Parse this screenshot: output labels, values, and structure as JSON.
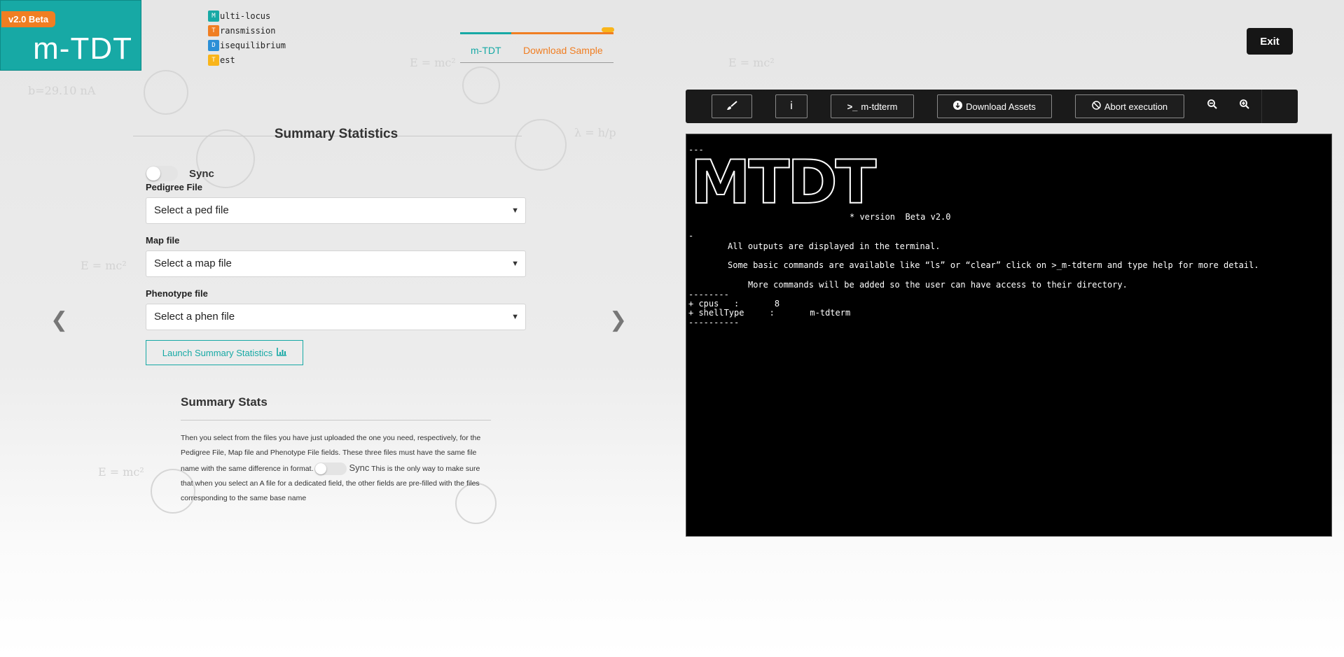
{
  "logo": {
    "badge": "v2.0 Beta",
    "title": "m-TDT"
  },
  "acronym": [
    {
      "letter": "M",
      "rest": "ulti-locus",
      "color": "#17a9a5"
    },
    {
      "letter": "T",
      "rest": "ransmission",
      "color": "#f07e22"
    },
    {
      "letter": "D",
      "rest": "isequilibrium",
      "color": "#2b8fd6"
    },
    {
      "letter": "T",
      "rest": "est",
      "color": "#f9b51a"
    }
  ],
  "nav": {
    "tab_mtdt": "m-TDT",
    "tab_download": "Download Sample"
  },
  "exit_label": "Exit",
  "panel": {
    "title": "Summary Statistics",
    "sync_label": "Sync",
    "pedigree_label": "Pedigree File",
    "pedigree_value": "Select a ped file",
    "map_label": "Map file",
    "map_value": "Select a map file",
    "phenotype_label": "Phenotype file",
    "phenotype_value": "Select a phen file",
    "launch_label": "Launch Summary Statistics"
  },
  "summary": {
    "title": "Summary Stats",
    "text_part1": "Then you select from the files you have just uploaded the one you need, respectively, for the Pedigree File, Map file and Phenotype File fields. These three files must have the same file name with the same difference in format.",
    "inline_sync": "Sync",
    "text_part2": "This is the only way to make sure that when you select an A file for a dedicated field, the other fields are pre-filled with the files corresponding to the same base name"
  },
  "toolbar": {
    "brush_icon": "brush-icon",
    "info_label": "i",
    "terminal_label": "m-tdterm",
    "download_label": "Download Assets",
    "abort_label": "Abort execution"
  },
  "terminal": {
    "top_dashes": "---",
    "ascii_logo": "MTDT",
    "version": "* version  Beta v2.0",
    "single_dash": "-",
    "line1": "All outputs are displayed in the terminal.",
    "line2": "Some basic commands are available like “ls” or “clear” click on >_m-tdterm and type help for more detail.",
    "line3": "More commands will be added so the user can have access to their directory.",
    "dashes1": "--------",
    "cpus": "+ cpus   :       8",
    "shell": "+ shellType     :       m-tdterm",
    "dashes2": "----------"
  }
}
